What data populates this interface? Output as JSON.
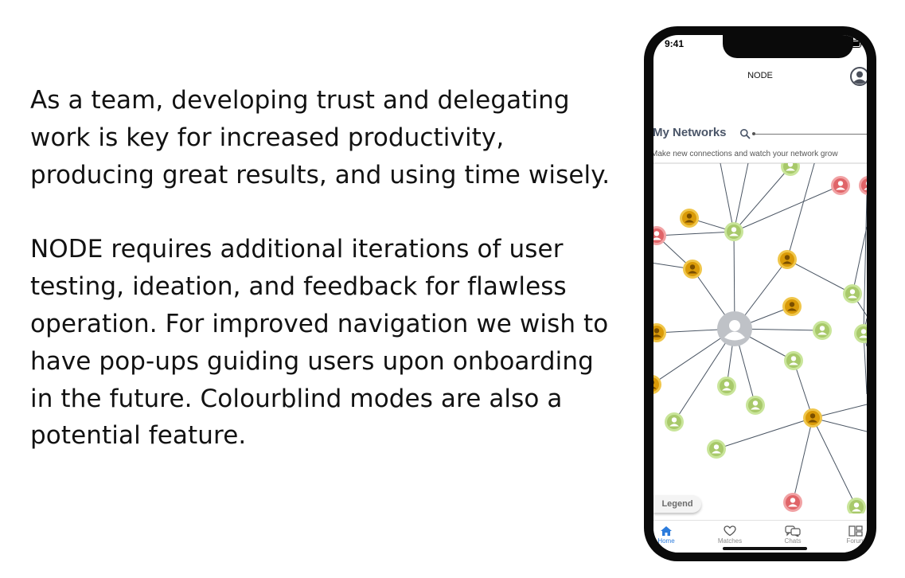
{
  "copy": {
    "paragraph_1": "As a team, developing trust and delegating work is key for increased productivity, producing great results, and using time wisely.",
    "paragraph_2": "NODE requires additional iterations of user testing, ideation, and feedback for flawless operation. For improved navigation we wish to have pop-ups guiding users upon onboarding in the future. Colourblind modes are also a potential feature."
  },
  "phone": {
    "status": {
      "time": "9:41",
      "icons": [
        "signal-icon",
        "wifi-icon",
        "battery-icon"
      ]
    },
    "app_title": "NODE",
    "avatar_icon": "user-avatar-icon",
    "section": {
      "title": "My Networks",
      "search_icon": "search-icon",
      "subtitle": "Make new connections and watch your network grow"
    },
    "legend_label": "Legend",
    "tabs": [
      {
        "label": "Home",
        "icon": "home-icon",
        "active": true
      },
      {
        "label": "Matches",
        "icon": "heart-icon",
        "active": false
      },
      {
        "label": "Chats",
        "icon": "chat-icon",
        "active": false
      },
      {
        "label": "Forum",
        "icon": "forum-icon",
        "active": false
      }
    ],
    "colors": {
      "accent": "#2b7bdc",
      "node_green": "#c9e59a",
      "node_yellow": "#e3a514",
      "node_red": "#e9777a",
      "node_center": "#bfc2c7",
      "edge": "#4a5563"
    }
  }
}
